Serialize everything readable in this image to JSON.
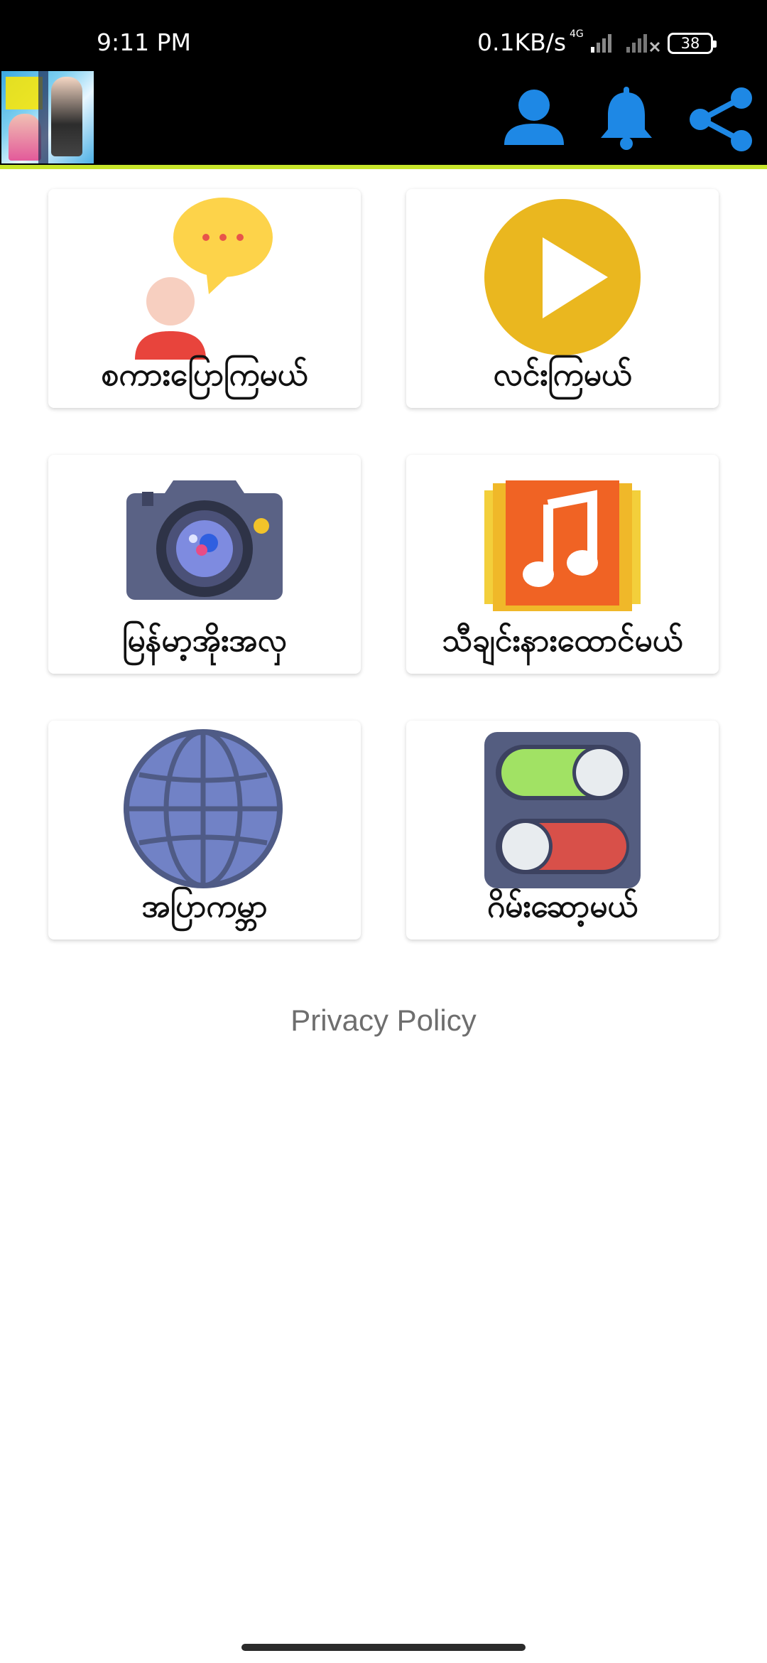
{
  "status_bar": {
    "time": "9:11 PM",
    "network_speed": "0.1KB/s",
    "network_type": "4G",
    "battery": "38"
  },
  "app_bar": {
    "profile_icon": "person-icon",
    "notification_icon": "bell-icon",
    "share_icon": "share-icon",
    "icon_color": "#1e88e5",
    "accent_line_color": "#c7e52a"
  },
  "menu": [
    {
      "label": "စကားပြောကြမယ်",
      "icon": "chat-person-icon"
    },
    {
      "label": "လင်းကြမယ်",
      "icon": "play-icon"
    },
    {
      "label": "မြန်မာ့အိုးအလှ",
      "icon": "camera-icon"
    },
    {
      "label": "သီချင်းနားထောင်မယ်",
      "icon": "music-icon"
    },
    {
      "label": "အပြာကမ္ဘာ",
      "icon": "globe-icon"
    },
    {
      "label": "ဂိမ်းဆော့မယ်",
      "icon": "toggle-switches-icon"
    }
  ],
  "footer": {
    "privacy_policy": "Privacy Policy"
  }
}
